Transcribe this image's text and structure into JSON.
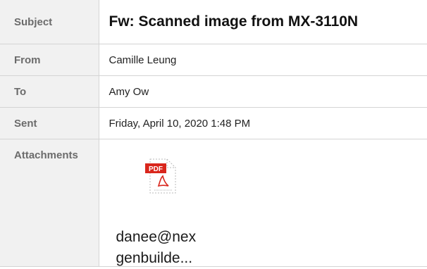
{
  "headers": {
    "subject": {
      "label": "Subject",
      "value": "Fw: Scanned image from MX-3110N"
    },
    "from": {
      "label": "From",
      "value": "Camille Leung"
    },
    "to": {
      "label": "To",
      "value": "Amy Ow"
    },
    "sent": {
      "label": "Sent",
      "value": "Friday, April 10, 2020 1:48 PM"
    },
    "attachments": {
      "label": "Attachments",
      "items": [
        {
          "icon": "pdf-file-icon",
          "icon_text": "PDF",
          "name_line1": "danee@nex",
          "name_line2": "genbuilde..."
        }
      ]
    }
  },
  "colors": {
    "label_bg": "#f1f1f1",
    "pdf_red": "#d9261c",
    "border": "#d4d4d4"
  }
}
